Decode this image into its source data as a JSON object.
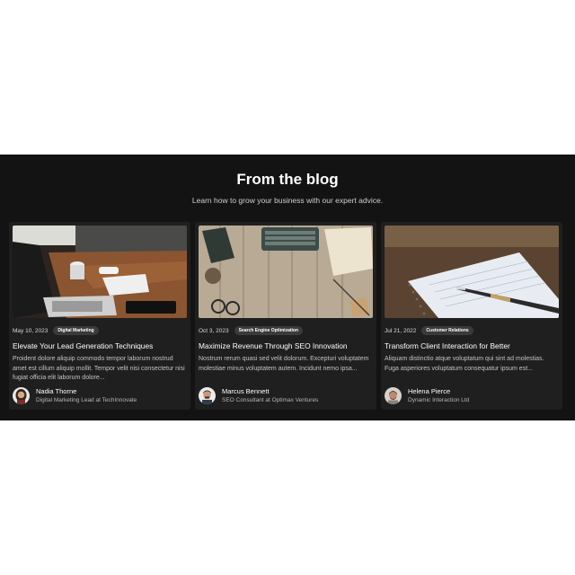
{
  "blog": {
    "title": "From the blog",
    "subtitle": "Learn how to grow your business with our expert advice.",
    "posts": [
      {
        "date": "May 10, 2023",
        "category": "Digital Marketing",
        "title": "Elevate Your Lead Generation Techniques",
        "excerpt": "Proident dolore aliquip commodo tempor laborum nostrud amet est cillum aliquip mollit. Tempor velit nisi consectetur nisi fugiat officia elit laborum dolore...",
        "author": {
          "name": "Nadia Thorne",
          "role": "Digital Marketing Lead at TechInnovate"
        },
        "image_icon": "laptop-desk-photo"
      },
      {
        "date": "Oct 3, 2023",
        "category": "Search Engine Optimization",
        "title": "Maximize Revenue Through SEO Innovation",
        "excerpt": "Nostrum rerum quasi sed velit dolorum. Excepturi voluptatem molestiae minus voluptatem autem. Incidunt nemo ipsa...",
        "author": {
          "name": "Marcus Bennett",
          "role": "SEO Consultant at Optimax Ventures"
        },
        "image_icon": "typewriter-desk-photo"
      },
      {
        "date": "Jul 21, 2022",
        "category": "Customer Relations",
        "title": "Transform Client Interaction for Better",
        "excerpt": "Aliquam distinctio atque voluptatum qui sint ad molestias. Fuga asperiores voluptatum consequatur ipsum est...",
        "author": {
          "name": "Helena Pierce",
          "role": "Dynamic Interaction Ltd"
        },
        "image_icon": "notebook-pen-photo"
      }
    ]
  },
  "colors": {
    "section_bg": "#131313",
    "card_bg": "#1f1f1f",
    "tag_bg": "#3a3a3a",
    "text": "#ffffff"
  }
}
